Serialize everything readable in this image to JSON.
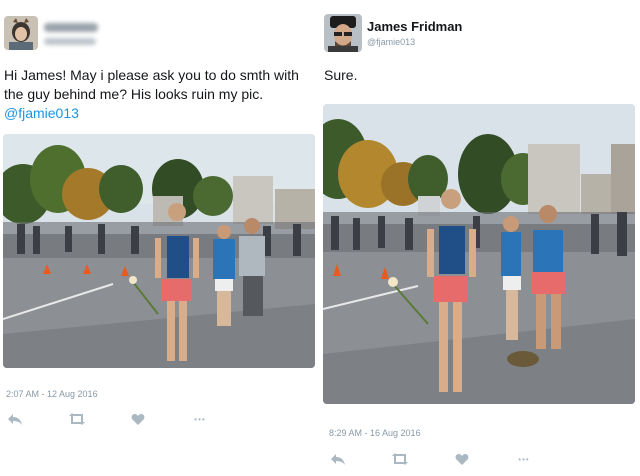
{
  "tweets": [
    {
      "author_name": "",
      "author_handle": "",
      "text": "Hi James! May i please ask you to do smth with the guy behind me? His looks ruin my pic.",
      "mention": "@fjamie013",
      "timestamp": "2:07 AM - 12 Aug 2016"
    },
    {
      "author_name": "James Fridman",
      "author_handle": "@fjamie013",
      "text": "Sure.",
      "timestamp": "8:29 AM - 16 Aug 2016"
    }
  ],
  "actions": {
    "icons": [
      "reply-icon",
      "retweet-icon",
      "like-icon",
      "more-icon"
    ],
    "more_label": "•••"
  },
  "colors": {
    "accent": "#1b95e0",
    "meta_text": "#8899a6",
    "action_icon": "#aab8c2"
  }
}
